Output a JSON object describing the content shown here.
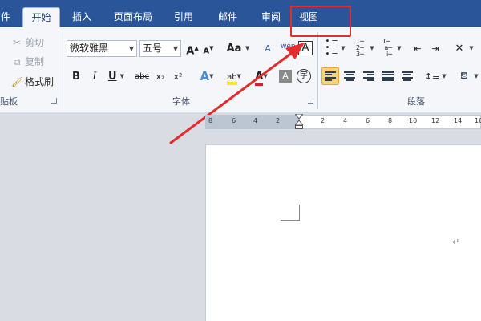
{
  "tabs": {
    "file": "件",
    "home": "开始",
    "insert": "插入",
    "layout": "页面布局",
    "references": "引用",
    "mailings": "邮件",
    "review": "审阅",
    "view": "视图"
  },
  "clipboard": {
    "cut": "剪切",
    "copy": "复制",
    "format_painter": "格式刷",
    "group_label": "贴板"
  },
  "font": {
    "font_name": "微软雅黑",
    "font_size": "五号",
    "grow_label": "A",
    "shrink_label": "A",
    "case_label": "Aa",
    "clear_label": "A",
    "char_border": "A",
    "bold": "B",
    "italic": "I",
    "underline": "U",
    "strike": "abc",
    "subscript": "x₂",
    "superscript": "x²",
    "text_effect": "A",
    "highlight": "ab",
    "font_color": "A",
    "char_shading": "A",
    "enclose": "字",
    "group_label": "字体"
  },
  "paragraph": {
    "group_label": "段落"
  },
  "ruler": {
    "ticks": [
      "8",
      "6",
      "4",
      "2",
      "2",
      "4",
      "6",
      "8",
      "10",
      "12",
      "14",
      "16"
    ]
  },
  "document": {
    "paragraph_mark": "↵"
  },
  "colors": {
    "tab_bar": "#2a5699",
    "ribbon": "#f4f6f9",
    "highlight": "#e52b2b",
    "active_align": "#fbd17a"
  }
}
